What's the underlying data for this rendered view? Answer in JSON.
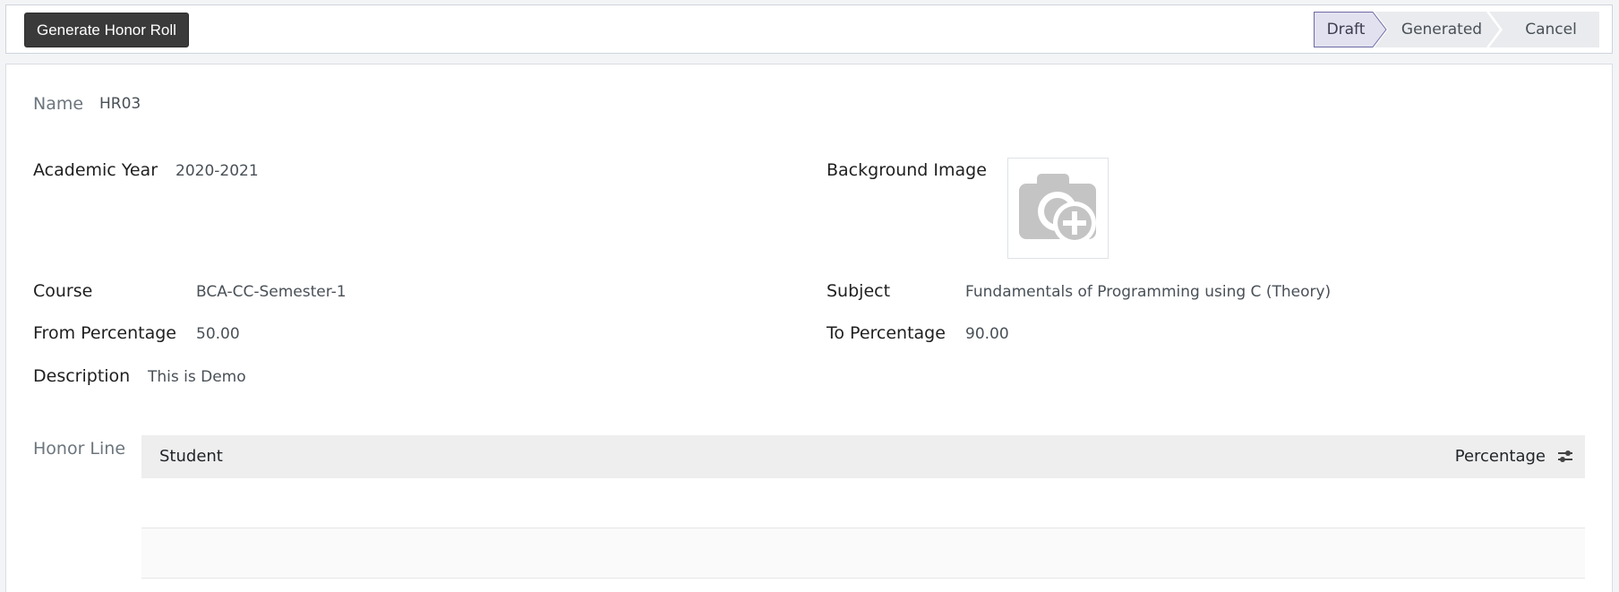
{
  "toolbar": {
    "generate_label": "Generate Honor Roll"
  },
  "stages": [
    {
      "label": "Draft",
      "active": true
    },
    {
      "label": "Generated",
      "active": false
    },
    {
      "label": "Cancel",
      "active": false
    }
  ],
  "form": {
    "name_label": "Name",
    "name_value": "HR03",
    "academic_year_label": "Academic Year",
    "academic_year_value": "2020-2021",
    "background_image_label": "Background Image",
    "course_label": "Course",
    "course_value": "BCA-CC-Semester-1",
    "subject_label": "Subject",
    "subject_value": "Fundamentals of Programming using C (Theory)",
    "from_percentage_label": "From Percentage",
    "from_percentage_value": "50.00",
    "to_percentage_label": "To Percentage",
    "to_percentage_value": "90.00",
    "description_label": "Description",
    "description_value": "This is Demo"
  },
  "honor_line": {
    "label": "Honor Line",
    "columns": [
      "Student",
      "Percentage"
    ],
    "rows": []
  },
  "icons": {
    "image_placeholder": "camera-plus-icon",
    "optional_columns": "sliders-icon"
  },
  "colors": {
    "primary_button": "#3a3a3a",
    "active_stage": "#e2e1ef",
    "active_stage_border": "#6f6aa3",
    "inactive_stage": "#e9ebee"
  }
}
